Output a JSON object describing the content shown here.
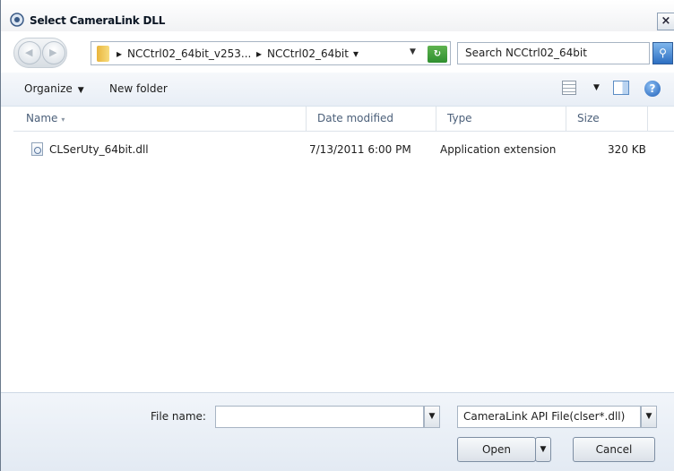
{
  "window": {
    "title": "Select CameraLink DLL",
    "close_glyph": "×"
  },
  "nav": {
    "back_icon": "back-arrow-icon",
    "forward_icon": "forward-arrow-icon",
    "breadcrumbs": [
      "NCCtrl02_64bit_v253...",
      "NCCtrl02_64bit"
    ],
    "search_placeholder": "Search NCCtrl02_64bit"
  },
  "toolbar": {
    "organize_label": "Organize",
    "new_folder_label": "New folder"
  },
  "columns": {
    "name": "Name",
    "date": "Date modified",
    "type": "Type",
    "size": "Size"
  },
  "files": [
    {
      "name": "CLSerUty_64bit.dll",
      "date": "7/13/2011 6:00 PM",
      "type": "Application extension",
      "size": "320 KB"
    }
  ],
  "bottom": {
    "filename_label": "File name:",
    "filename_value": "",
    "filter_value": "CameraLink API File(clser*.dll)",
    "open_label": "Open",
    "cancel_label": "Cancel"
  },
  "colors": {
    "accent": "#2d6fc2",
    "header_text": "#4c607a"
  }
}
